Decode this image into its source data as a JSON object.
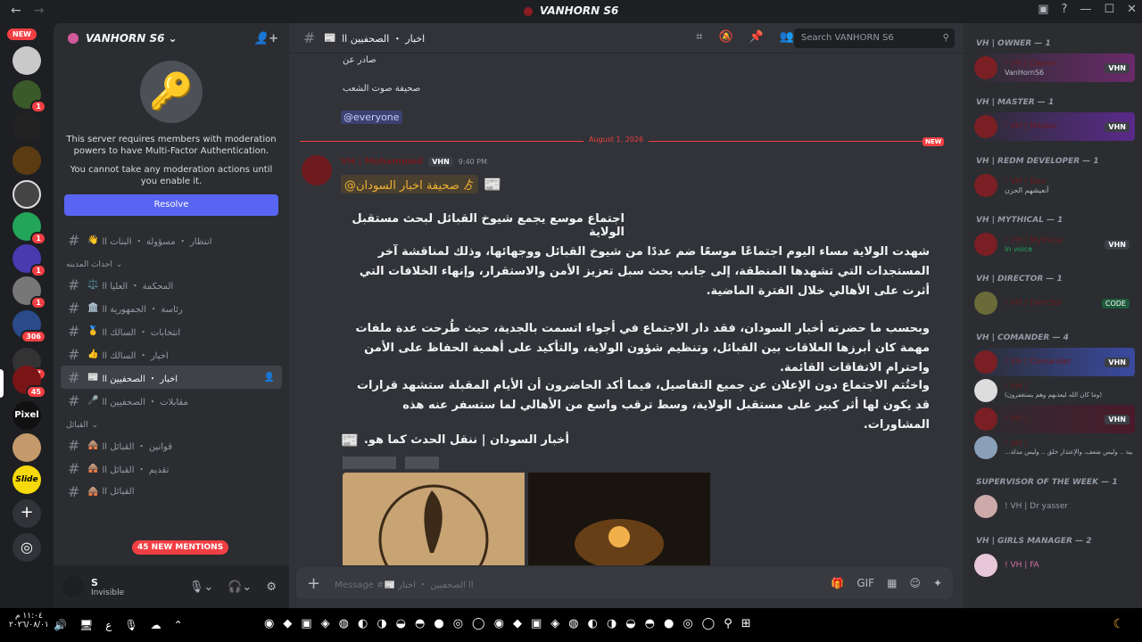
{
  "window": {
    "title": "VANHORN S6",
    "back": "←",
    "forward": "→"
  },
  "guilds": {
    "new_badge": "NEW",
    "badges": [
      "1",
      "1",
      "1",
      "1",
      "306",
      "237",
      "45"
    ],
    "pixel_label": "Pixel",
    "slide_label": "Slide",
    "add_server": "+",
    "discover": "◎"
  },
  "sidebar": {
    "server_name": "VANHORN S6",
    "mfa_line1": "This server requires members with moderation powers to have Multi-Factor Authentication.",
    "mfa_line2": "You cannot take any moderation actions until you enable it.",
    "resolve": "Resolve",
    "channels_top": [
      {
        "label": "انتظار ・ مسؤولة ・ البنات اا",
        "emoji": "👋"
      }
    ],
    "category1": "احداث المدينه",
    "channels_cat1": [
      {
        "label": "المحكمة ・ العليا اا",
        "emoji": "⚖️",
        "active": false
      },
      {
        "label": "رئاسة ・ الجمهورية اا",
        "emoji": "🏛️",
        "active": false
      },
      {
        "label": "انتخابات ・ السالك اا",
        "emoji": "🥇",
        "active": false
      },
      {
        "label": "اخبار ・ السالك اا",
        "emoji": "👍",
        "active": false
      },
      {
        "label": "اخبار ・ الصحفيين اا",
        "emoji": "📰",
        "active": true
      },
      {
        "label": "مقابلات ・ الصحفيين اا",
        "emoji": "🎤",
        "active": false
      }
    ],
    "category2": "القبائل",
    "channels_cat2": [
      {
        "label": "قوانين ・ القبائل اا",
        "emoji": "🛖"
      },
      {
        "label": "تقديم ・ القبائل اا",
        "emoji": "🛖"
      },
      {
        "label": "القبائل اا",
        "emoji": "🛖"
      }
    ],
    "new_mentions": "45 NEW MENTIONS"
  },
  "user_panel": {
    "name": "S",
    "status": "Invisible"
  },
  "channel_header": {
    "name": "اخبار ・ الصحفيين اا",
    "search_placeholder": "Search VANHORN S6"
  },
  "messages": {
    "prev_line1": "صادر عن",
    "prev_line2": "صحيفة صوت الشعب",
    "everyone": "@everyone",
    "date_divider": "August 1, 2026",
    "date_new": "NEW",
    "author": "VH | Mohammed",
    "author_tag": "VHN",
    "time": "9:40 PM",
    "mention": "@صحيفة اخبار السودان ゟ",
    "headline": "اجتماع موسع يجمع شيوخ القبائل لبحث مستقبل الولاية",
    "para1": "شهدت الولاية مساء اليوم اجتماعًا موسعًا ضم عددًا من شيوخ القبائل ووجهائها، وذلك لمناقشة آخر المستجدات التي تشهدها المنطقة، إلى جانب بحث سبل تعزيز الأمن والاستقرار، وإنهاء الخلافات التي أثرت على الأهالي خلال الفترة الماضية.",
    "para2": "وبحسب ما حضرته أخبار السودان، فقد دار الاجتماع في أجواء اتسمت بالجدية، حيث طُرحت عدة ملفات مهمة كان أبرزها العلاقات بين القبائل، وتنظيم شؤون الولاية، والتأكيد على أهمية الحفاظ على الأمن واحترام الاتفاقات القائمة.",
    "para3": "واختُتم الاجتماع دون الإعلان عن جميع التفاصيل، فيما أكد الحاضرون أن الأيام المقبلة ستشهد قرارات قد يكون لها أثر كبير على مستقبل الولاية، وسط ترقب واسع من الأهالي لما ستسفر عنه هذه المشاورات.",
    "sign": "أخبار السودان | ننقل الحدث كما هو."
  },
  "composer": {
    "placeholder": "Message #📰 اا الصحفيين ・ اخبار"
  },
  "members": {
    "groups": [
      {
        "title": "VH | OWNER — 1",
        "members": [
          {
            "name": "! VH | Owner",
            "sub": "VanHornS6",
            "tag": "VHN"
          }
        ]
      },
      {
        "title": "VH | MASTER — 1",
        "members": [
          {
            "name": "! VH | Master",
            "sub": "",
            "tag": "VHN"
          }
        ]
      },
      {
        "title": "VH | REDM DEVELOPER — 1",
        "members": [
          {
            "name": "! VH | Dev",
            "sub": "أنعيشهم الحزن",
            "tag": ""
          }
        ]
      },
      {
        "title": "VH | MYTHICAL — 1",
        "members": [
          {
            "name": "! VH | Mythical",
            "sub": "In voice",
            "tag": "VHN"
          }
        ]
      },
      {
        "title": "VH | DIRECTOR — 1",
        "members": [
          {
            "name": "! VH | Director",
            "sub": "",
            "tag": "CODE"
          }
        ]
      },
      {
        "title": "VH | COMANDER — 4",
        "members": [
          {
            "name": "! VH | Comander",
            "sub": "",
            "tag": "VHN"
          },
          {
            "name": "! VH |",
            "sub": "(وما كان الله ليعذبهم وهم يستغفرون)",
            "tag": ""
          },
          {
            "name": "! VH |",
            "sub": "",
            "tag": "VHN"
          },
          {
            "name": "! VH |",
            "sub": "...بية .. وليس ضعف، والإعتذار خلق .. وليس مذلة",
            "tag": ""
          }
        ]
      },
      {
        "title": "SUPERVISOR OF THE WEEK — 1",
        "members": [
          {
            "name": "! VH | Dr yasser",
            "sub": "",
            "tag": ""
          }
        ]
      },
      {
        "title": "VH | GIRLS MANAGER — 2",
        "members": [
          {
            "name": "! VH | FA",
            "sub": "",
            "tag": ""
          }
        ]
      }
    ]
  },
  "taskbar": {
    "time": "١١:٠٤ م",
    "date": "٢٠٢٦/٠٨/٠١",
    "lang": "ع"
  }
}
